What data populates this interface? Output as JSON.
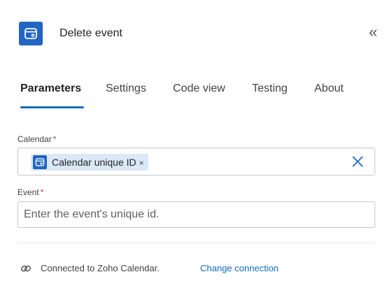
{
  "header": {
    "title": "Delete event",
    "app_icon": "calendar-app-icon",
    "collapse_glyph": "«"
  },
  "tabs": [
    {
      "label": "Parameters",
      "active": true
    },
    {
      "label": "Settings",
      "active": false
    },
    {
      "label": "Code view",
      "active": false
    },
    {
      "label": "Testing",
      "active": false
    },
    {
      "label": "About",
      "active": false
    }
  ],
  "calendar_field": {
    "label": "Calendar",
    "required_marker": "*",
    "token_label": "Calendar unique ID",
    "token_remove": "×"
  },
  "event_field": {
    "label": "Event",
    "required_marker": "*",
    "placeholder": "Enter the event's unique id."
  },
  "connection": {
    "text": "Connected to Zoho Calendar.",
    "change_label": "Change connection"
  },
  "colors": {
    "accent": "#0f6cbd",
    "app_icon_bg": "#2266c4",
    "token_bg": "#dbe8f7",
    "required": "#c4314b"
  }
}
